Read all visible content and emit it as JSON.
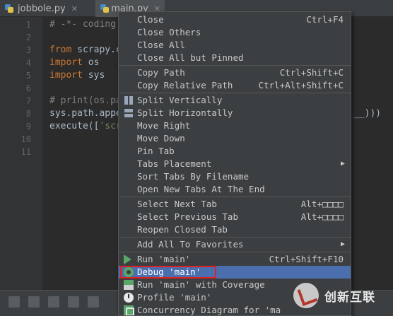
{
  "tabs": [
    {
      "label": "jobbole.py",
      "close": "✕"
    },
    {
      "label": "main.py",
      "close": "✕"
    }
  ],
  "gutter": [
    "1",
    "2",
    "3",
    "4",
    "5",
    "6",
    "7",
    "8",
    "9",
    "10",
    "11"
  ],
  "code": {
    "l1": "# -*- coding:",
    "l3_kw": "from",
    "l3_rest": " scrapy.c",
    "l4_kw": "import",
    "l4_rest": " os",
    "l5_kw": "import",
    "l5_rest": " sys",
    "l7": "# print(os.pa",
    "l8": "sys.path.appe",
    "l8_tail": "__)))",
    "l9_a": "execute([",
    "l9_b": "'scr"
  },
  "menu": {
    "close": "Close",
    "close_sc": "Ctrl+F4",
    "close_others": "Close Others",
    "close_all": "Close All",
    "close_all_but_pinned": "Close All but Pinned",
    "copy_path": "Copy Path",
    "copy_path_sc": "Ctrl+Shift+C",
    "copy_relative_path": "Copy Relative Path",
    "copy_relative_path_sc": "Ctrl+Alt+Shift+C",
    "split_vertically": "Split Vertically",
    "split_horizontally": "Split Horizontally",
    "move_right": "Move Right",
    "move_down": "Move Down",
    "pin_tab": "Pin Tab",
    "tabs_placement": "Tabs Placement",
    "sort_tabs": "Sort Tabs By Filename",
    "open_new_tabs_end": "Open New Tabs At The End",
    "select_next_tab": "Select Next Tab",
    "select_next_tab_sc": "Alt+□□□□",
    "select_previous_tab": "Select Previous Tab",
    "select_previous_tab_sc": "Alt+□□□□",
    "reopen_closed_tab": "Reopen Closed Tab",
    "add_all_favorites": "Add All To Favorites",
    "run_main": "Run 'main'",
    "run_main_sc": "Ctrl+Shift+F10",
    "debug_main": "Debug 'main'",
    "run_coverage": "Run 'main' with Coverage",
    "profile_main": "Profile 'main'",
    "concurrency": "Concurrency Diagram for  'ma"
  },
  "submenu_arrow": "▶",
  "watermark": {
    "text": "创新互联"
  },
  "colors": {
    "selected": "#4b6eaf",
    "highlight_box": "#e02020",
    "run_green": "#59a869"
  }
}
